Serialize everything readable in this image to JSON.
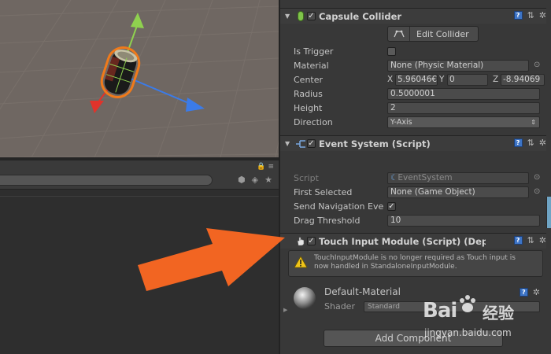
{
  "capsule_collider": {
    "title": "Capsule Collider",
    "edit_collider_label": "Edit Collider",
    "is_trigger_label": "Is Trigger",
    "material_label": "Material",
    "material_value": "None (Physic Material)",
    "center_label": "Center",
    "center": {
      "x_label": "X",
      "x": "5.96046€",
      "y_label": "Y",
      "y": "0",
      "z_label": "Z",
      "z": "-8.94069"
    },
    "radius_label": "Radius",
    "radius_value": "0.5000001",
    "height_label": "Height",
    "height_value": "2",
    "direction_label": "Direction",
    "direction_value": "Y-Axis"
  },
  "event_system": {
    "title": "Event System (Script)",
    "script_label": "Script",
    "script_value": "EventSystem",
    "first_selected_label": "First Selected",
    "first_selected_value": "None (Game Object)",
    "send_navigation_label": "Send Navigation Eve",
    "drag_threshold_label": "Drag Threshold",
    "drag_threshold_value": "10"
  },
  "touch_input": {
    "title": "Touch Input Module (Script) (Dep",
    "warning_line1": "TouchInputModule is no longer required as Touch input is",
    "warning_line2": "now handled in StandaloneInputModule."
  },
  "material": {
    "name": "Default-Material",
    "shader_label": "Shader",
    "shader_value": "Standard"
  },
  "add_component_label": "Add Component",
  "watermark": {
    "logo": "Bai",
    "logo_cn": "经验",
    "url": "jingyan.baidu.com"
  },
  "colors": {
    "scene_bg": "#6f6762",
    "inspector_bg": "#383838",
    "arrow": "#f26522",
    "selection_outline": "#f07a1a",
    "gizmo_y": "#8fd14f",
    "gizmo_x": "#e0332b",
    "gizmo_z": "#3b7be8"
  }
}
